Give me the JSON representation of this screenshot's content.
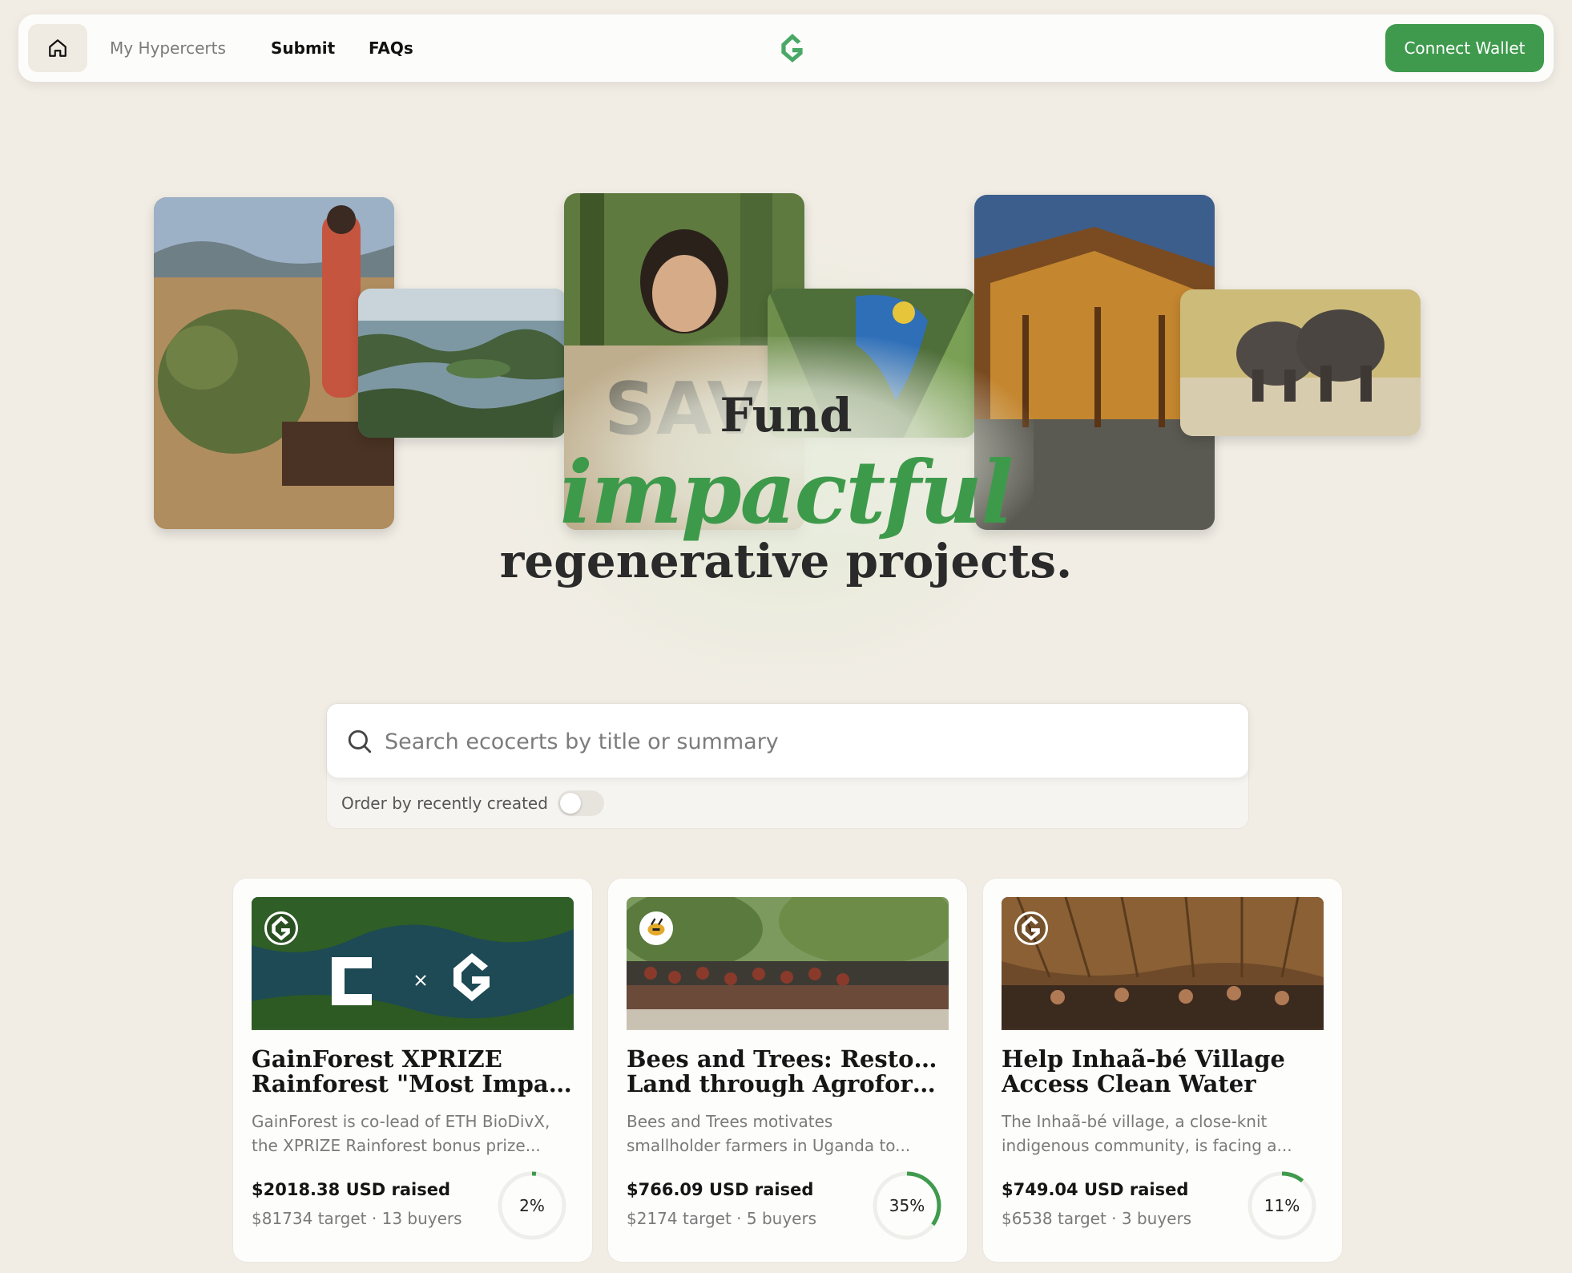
{
  "nav": {
    "home_icon": "home-icon",
    "links": [
      "My Hypercerts",
      "Submit",
      "FAQs"
    ],
    "logo_icon": "gainforest-logo-icon",
    "connect_label": "Connect Wallet"
  },
  "hero": {
    "line1": "Fund",
    "line2": "impactful",
    "line3": "regenerative projects."
  },
  "search": {
    "placeholder": "Search ecocerts by title or summary",
    "value": "",
    "order_label": "Order by recently created",
    "order_enabled": false
  },
  "cards": [
    {
      "title_line1": "GainForest XPRIZE",
      "title_line2": "Rainforest \"Most Impact\"...",
      "summary_line1": "GainForest is co-lead of ETH BioDivX,",
      "summary_line2": "the XPRIZE Rainforest bonus prize...",
      "raised": "$2018.38 USD raised",
      "target": "$81734 target · 13 buyers",
      "percent_label": "2%",
      "percent": 2
    },
    {
      "title_line1": "Bees and Trees: Restoring",
      "title_line2": "Land through Agroforestr...",
      "summary_line1": "Bees and Trees motivates",
      "summary_line2": "smallholder farmers in Uganda to...",
      "raised": "$766.09 USD raised",
      "target": "$2174 target · 5 buyers",
      "percent_label": "35%",
      "percent": 35
    },
    {
      "title_line1": "Help Inhaã-bé Village",
      "title_line2": "Access Clean Water",
      "summary_line1": "The Inhaã-bé village, a close-knit",
      "summary_line2": "indigenous community, is facing a...",
      "raised": "$749.04 USD raised",
      "target": "$6538 target · 3 buyers",
      "percent_label": "11%",
      "percent": 11
    }
  ],
  "colors": {
    "accent": "#3f9a4d",
    "background": "#f1ede5"
  }
}
